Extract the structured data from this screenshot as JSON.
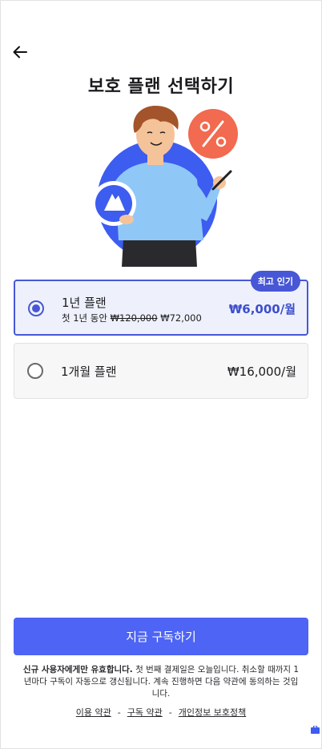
{
  "header": {
    "back_icon": "arrow-left-icon",
    "title": "보호 플랜 선택하기"
  },
  "hero": {
    "illustration": "person-holding-pen-icon",
    "colors": {
      "circle": "#3d5cf0",
      "percent_badge": "#f26a4f",
      "shirt": "#8fc8f7",
      "hair": "#a4542a",
      "skin": "#f5c39a"
    }
  },
  "plans": [
    {
      "name": "1년 플랜",
      "sub_prefix": "첫 1년 동안",
      "old_price": "₩120,000",
      "new_price": "₩72,000",
      "price": "₩6,000/월",
      "badge": "최고 인기",
      "selected": true
    },
    {
      "name": "1개월 플랜",
      "price": "₩16,000/월",
      "selected": false
    }
  ],
  "cta": {
    "label": "지금 구독하기"
  },
  "notice": {
    "bold": "신규 사용자에게만 유효합니다.",
    "text": " 첫 번째 결제일은 오늘입니다. 취소할 때까지 1년마다 구독이 자동으로 갱신됩니다. 계속 진행하면 다음 약관에 동의하는 것입니다."
  },
  "links": {
    "terms": "이용 약관",
    "subscription": "구독 약관",
    "privacy": "개인정보 보호정책",
    "separator": "-"
  },
  "colors": {
    "accent": "#4d64f5",
    "selected_border": "#4757d6",
    "selected_bg": "#eef1fb"
  }
}
